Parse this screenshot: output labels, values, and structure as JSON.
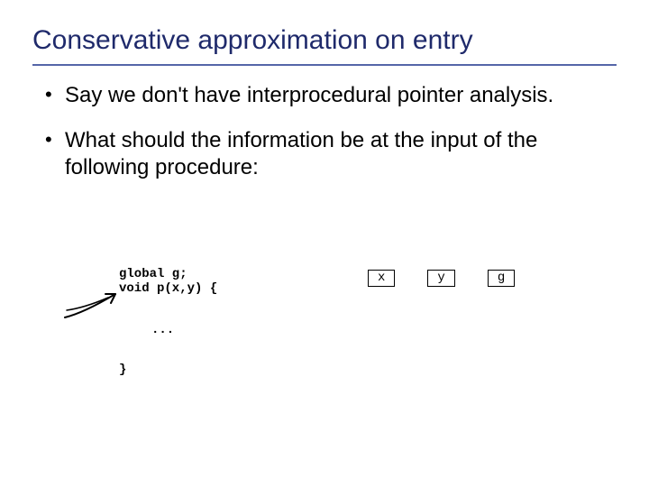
{
  "title": "Conservative approximation on entry",
  "bullets": [
    "Say we don't have interprocedural pointer analysis.",
    "What should the information be at the input of the following procedure:"
  ],
  "code": {
    "decl_line": "global g;",
    "sig_line": "void p(x,y) {",
    "body": "...",
    "close": "}"
  },
  "vars": [
    "x",
    "y",
    "g"
  ]
}
